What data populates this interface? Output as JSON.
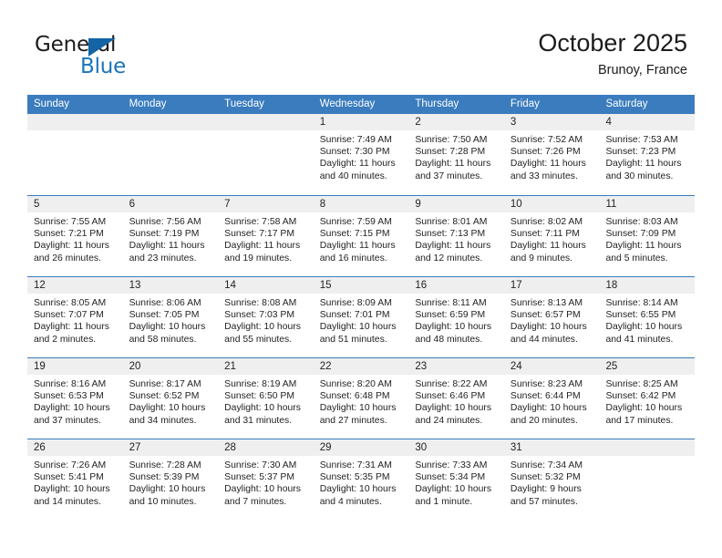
{
  "brand": {
    "name_primary": "General",
    "name_secondary": "Blue",
    "triangle_color": "#1464a5",
    "secondary_color": "#1a74bb"
  },
  "header": {
    "title": "October 2025",
    "subtitle": "Brunoy, France"
  },
  "theme": {
    "header_row_bg": "#3a7cbe",
    "daynum_bg": "#efefef",
    "text_color": "#232323"
  },
  "weekday_headers": [
    "Sunday",
    "Monday",
    "Tuesday",
    "Wednesday",
    "Thursday",
    "Friday",
    "Saturday"
  ],
  "labels": {
    "sunrise_prefix": "Sunrise:",
    "sunset_prefix": "Sunset:",
    "daylight_prefix": "Daylight:"
  },
  "weeks": [
    [
      {
        "day": "",
        "empty": true,
        "lines": []
      },
      {
        "day": "",
        "empty": true,
        "lines": []
      },
      {
        "day": "",
        "empty": true,
        "lines": []
      },
      {
        "day": "1",
        "empty": false,
        "lines": [
          "Sunrise: 7:49 AM",
          "Sunset: 7:30 PM",
          "Daylight: 11 hours",
          "and 40 minutes."
        ]
      },
      {
        "day": "2",
        "empty": false,
        "lines": [
          "Sunrise: 7:50 AM",
          "Sunset: 7:28 PM",
          "Daylight: 11 hours",
          "and 37 minutes."
        ]
      },
      {
        "day": "3",
        "empty": false,
        "lines": [
          "Sunrise: 7:52 AM",
          "Sunset: 7:26 PM",
          "Daylight: 11 hours",
          "and 33 minutes."
        ]
      },
      {
        "day": "4",
        "empty": false,
        "lines": [
          "Sunrise: 7:53 AM",
          "Sunset: 7:23 PM",
          "Daylight: 11 hours",
          "and 30 minutes."
        ]
      }
    ],
    [
      {
        "day": "5",
        "empty": false,
        "lines": [
          "Sunrise: 7:55 AM",
          "Sunset: 7:21 PM",
          "Daylight: 11 hours",
          "and 26 minutes."
        ]
      },
      {
        "day": "6",
        "empty": false,
        "lines": [
          "Sunrise: 7:56 AM",
          "Sunset: 7:19 PM",
          "Daylight: 11 hours",
          "and 23 minutes."
        ]
      },
      {
        "day": "7",
        "empty": false,
        "lines": [
          "Sunrise: 7:58 AM",
          "Sunset: 7:17 PM",
          "Daylight: 11 hours",
          "and 19 minutes."
        ]
      },
      {
        "day": "8",
        "empty": false,
        "lines": [
          "Sunrise: 7:59 AM",
          "Sunset: 7:15 PM",
          "Daylight: 11 hours",
          "and 16 minutes."
        ]
      },
      {
        "day": "9",
        "empty": false,
        "lines": [
          "Sunrise: 8:01 AM",
          "Sunset: 7:13 PM",
          "Daylight: 11 hours",
          "and 12 minutes."
        ]
      },
      {
        "day": "10",
        "empty": false,
        "lines": [
          "Sunrise: 8:02 AM",
          "Sunset: 7:11 PM",
          "Daylight: 11 hours",
          "and 9 minutes."
        ]
      },
      {
        "day": "11",
        "empty": false,
        "lines": [
          "Sunrise: 8:03 AM",
          "Sunset: 7:09 PM",
          "Daylight: 11 hours",
          "and 5 minutes."
        ]
      }
    ],
    [
      {
        "day": "12",
        "empty": false,
        "lines": [
          "Sunrise: 8:05 AM",
          "Sunset: 7:07 PM",
          "Daylight: 11 hours",
          "and 2 minutes."
        ]
      },
      {
        "day": "13",
        "empty": false,
        "lines": [
          "Sunrise: 8:06 AM",
          "Sunset: 7:05 PM",
          "Daylight: 10 hours",
          "and 58 minutes."
        ]
      },
      {
        "day": "14",
        "empty": false,
        "lines": [
          "Sunrise: 8:08 AM",
          "Sunset: 7:03 PM",
          "Daylight: 10 hours",
          "and 55 minutes."
        ]
      },
      {
        "day": "15",
        "empty": false,
        "lines": [
          "Sunrise: 8:09 AM",
          "Sunset: 7:01 PM",
          "Daylight: 10 hours",
          "and 51 minutes."
        ]
      },
      {
        "day": "16",
        "empty": false,
        "lines": [
          "Sunrise: 8:11 AM",
          "Sunset: 6:59 PM",
          "Daylight: 10 hours",
          "and 48 minutes."
        ]
      },
      {
        "day": "17",
        "empty": false,
        "lines": [
          "Sunrise: 8:13 AM",
          "Sunset: 6:57 PM",
          "Daylight: 10 hours",
          "and 44 minutes."
        ]
      },
      {
        "day": "18",
        "empty": false,
        "lines": [
          "Sunrise: 8:14 AM",
          "Sunset: 6:55 PM",
          "Daylight: 10 hours",
          "and 41 minutes."
        ]
      }
    ],
    [
      {
        "day": "19",
        "empty": false,
        "lines": [
          "Sunrise: 8:16 AM",
          "Sunset: 6:53 PM",
          "Daylight: 10 hours",
          "and 37 minutes."
        ]
      },
      {
        "day": "20",
        "empty": false,
        "lines": [
          "Sunrise: 8:17 AM",
          "Sunset: 6:52 PM",
          "Daylight: 10 hours",
          "and 34 minutes."
        ]
      },
      {
        "day": "21",
        "empty": false,
        "lines": [
          "Sunrise: 8:19 AM",
          "Sunset: 6:50 PM",
          "Daylight: 10 hours",
          "and 31 minutes."
        ]
      },
      {
        "day": "22",
        "empty": false,
        "lines": [
          "Sunrise: 8:20 AM",
          "Sunset: 6:48 PM",
          "Daylight: 10 hours",
          "and 27 minutes."
        ]
      },
      {
        "day": "23",
        "empty": false,
        "lines": [
          "Sunrise: 8:22 AM",
          "Sunset: 6:46 PM",
          "Daylight: 10 hours",
          "and 24 minutes."
        ]
      },
      {
        "day": "24",
        "empty": false,
        "lines": [
          "Sunrise: 8:23 AM",
          "Sunset: 6:44 PM",
          "Daylight: 10 hours",
          "and 20 minutes."
        ]
      },
      {
        "day": "25",
        "empty": false,
        "lines": [
          "Sunrise: 8:25 AM",
          "Sunset: 6:42 PM",
          "Daylight: 10 hours",
          "and 17 minutes."
        ]
      }
    ],
    [
      {
        "day": "26",
        "empty": false,
        "lines": [
          "Sunrise: 7:26 AM",
          "Sunset: 5:41 PM",
          "Daylight: 10 hours",
          "and 14 minutes."
        ]
      },
      {
        "day": "27",
        "empty": false,
        "lines": [
          "Sunrise: 7:28 AM",
          "Sunset: 5:39 PM",
          "Daylight: 10 hours",
          "and 10 minutes."
        ]
      },
      {
        "day": "28",
        "empty": false,
        "lines": [
          "Sunrise: 7:30 AM",
          "Sunset: 5:37 PM",
          "Daylight: 10 hours",
          "and 7 minutes."
        ]
      },
      {
        "day": "29",
        "empty": false,
        "lines": [
          "Sunrise: 7:31 AM",
          "Sunset: 5:35 PM",
          "Daylight: 10 hours",
          "and 4 minutes."
        ]
      },
      {
        "day": "30",
        "empty": false,
        "lines": [
          "Sunrise: 7:33 AM",
          "Sunset: 5:34 PM",
          "Daylight: 10 hours",
          "and 1 minute."
        ]
      },
      {
        "day": "31",
        "empty": false,
        "lines": [
          "Sunrise: 7:34 AM",
          "Sunset: 5:32 PM",
          "Daylight: 9 hours",
          "and 57 minutes."
        ]
      },
      {
        "day": "",
        "empty": true,
        "lines": []
      }
    ]
  ]
}
